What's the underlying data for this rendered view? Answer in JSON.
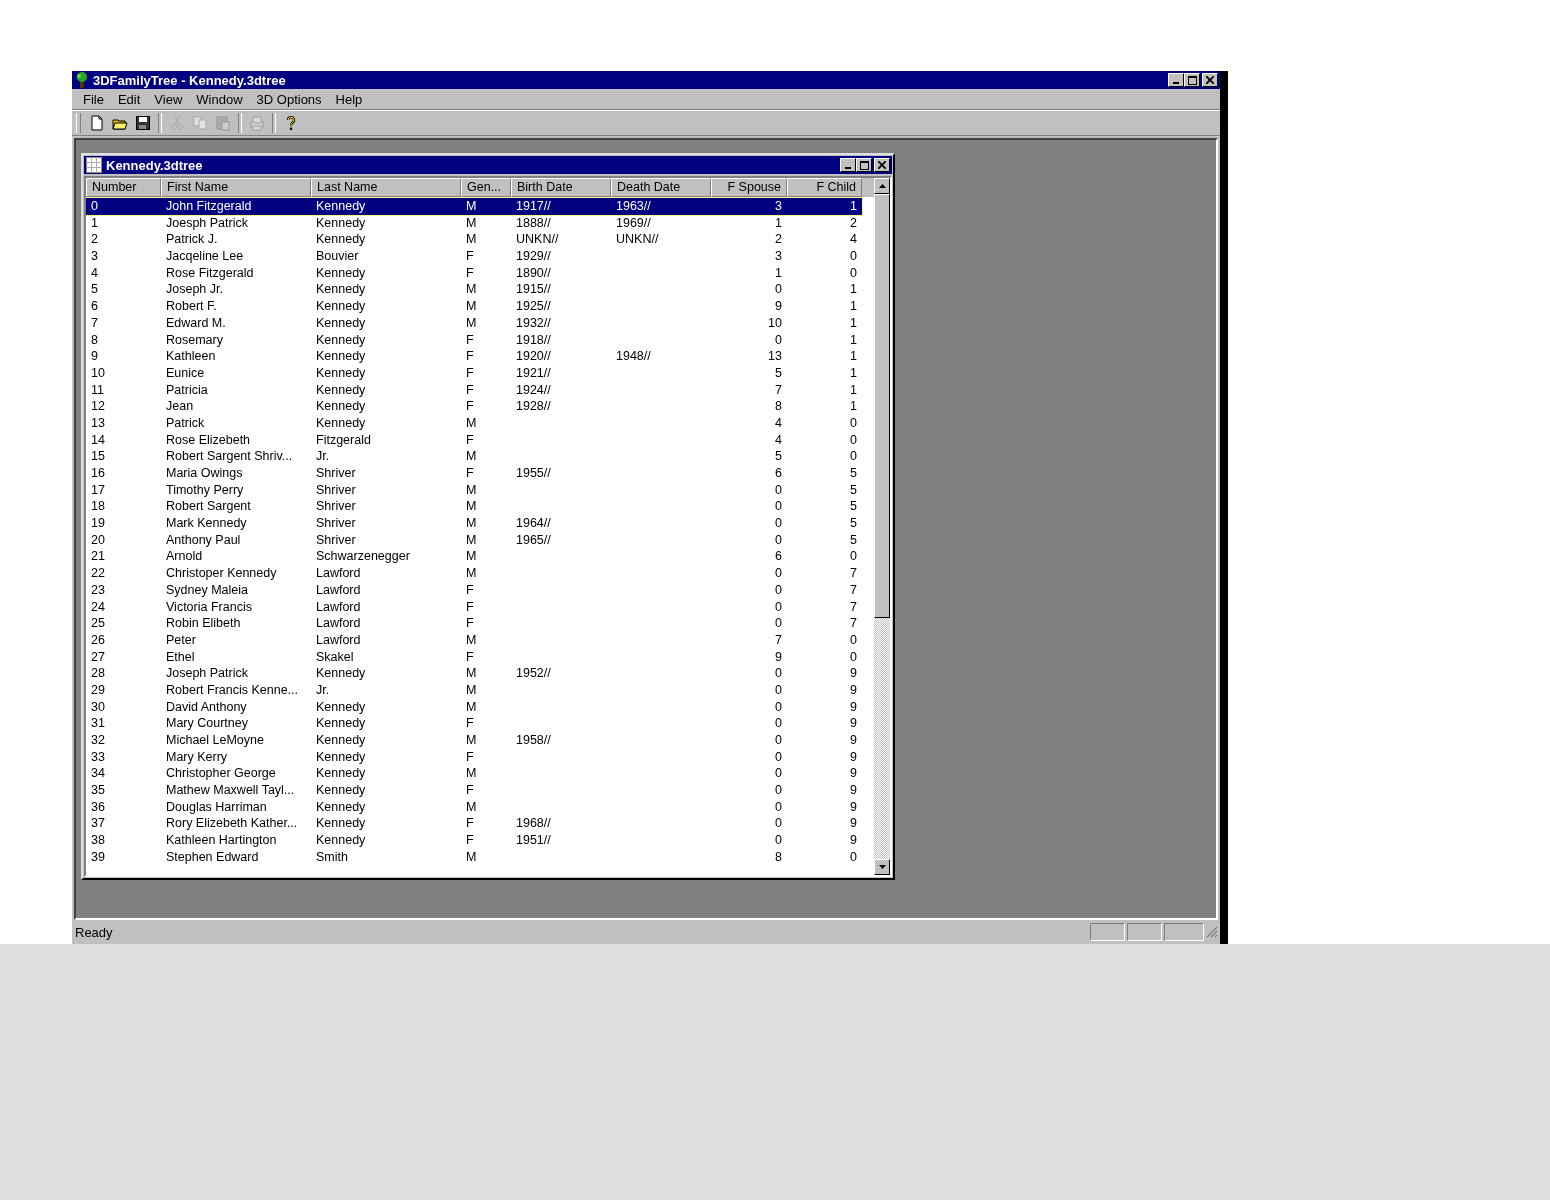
{
  "window": {
    "title": "3DFamilyTree - Kennedy.3dtree"
  },
  "menu": [
    "File",
    "Edit",
    "View",
    "Window",
    "3D Options",
    "Help"
  ],
  "toolbar": [
    {
      "kind": "new",
      "disabled": false
    },
    {
      "kind": "open",
      "disabled": false
    },
    {
      "kind": "save",
      "disabled": false
    },
    {
      "kind": "separator"
    },
    {
      "kind": "cut",
      "disabled": true
    },
    {
      "kind": "copy",
      "disabled": true
    },
    {
      "kind": "paste",
      "disabled": true
    },
    {
      "kind": "separator"
    },
    {
      "kind": "print",
      "disabled": true
    },
    {
      "kind": "separator"
    },
    {
      "kind": "help",
      "disabled": false
    }
  ],
  "document": {
    "title": "Kennedy.3dtree",
    "columns": [
      {
        "label": "Number",
        "kind": "text"
      },
      {
        "label": "First Name",
        "kind": "text"
      },
      {
        "label": "Last Name",
        "kind": "text"
      },
      {
        "label": "Gen...",
        "kind": "text"
      },
      {
        "label": "Birth Date",
        "kind": "text"
      },
      {
        "label": "Death Date",
        "kind": "text"
      },
      {
        "label": "F Spouse",
        "kind": "number"
      },
      {
        "label": "F Child",
        "kind": "number"
      }
    ],
    "rows": [
      {
        "number": "0",
        "first_name": "John Fitzgerald",
        "last_name": "Kennedy",
        "gender": "M",
        "birth_date": "1917//",
        "death_date": "1963//",
        "f_spouse": "3",
        "f_child": "1",
        "selected": true
      },
      {
        "number": "1",
        "first_name": "Joesph Patrick",
        "last_name": "Kennedy",
        "gender": "M",
        "birth_date": "1888//",
        "death_date": "1969//",
        "f_spouse": "1",
        "f_child": "2",
        "selected": false
      },
      {
        "number": "2",
        "first_name": "Patrick J.",
        "last_name": "Kennedy",
        "gender": "M",
        "birth_date": "UNKN//",
        "death_date": "UNKN//",
        "f_spouse": "2",
        "f_child": "4",
        "selected": false
      },
      {
        "number": "3",
        "first_name": "Jacqeline Lee",
        "last_name": "Bouvier",
        "gender": "F",
        "birth_date": "1929//",
        "f_spouse": "3",
        "f_child": "0",
        "selected": false
      },
      {
        "number": "4",
        "first_name": "Rose Fitzgerald",
        "last_name": "Kennedy",
        "gender": "F",
        "birth_date": "1890//",
        "f_spouse": "1",
        "f_child": "0",
        "selected": false
      },
      {
        "number": "5",
        "first_name": "Joseph Jr.",
        "last_name": "Kennedy",
        "gender": "M",
        "birth_date": "1915//",
        "f_spouse": "0",
        "f_child": "1",
        "selected": false
      },
      {
        "number": "6",
        "first_name": "Robert F.",
        "last_name": "Kennedy",
        "gender": "M",
        "birth_date": "1925//",
        "f_spouse": "9",
        "f_child": "1",
        "selected": false
      },
      {
        "number": "7",
        "first_name": "Edward M.",
        "last_name": "Kennedy",
        "gender": "M",
        "birth_date": "1932//",
        "f_spouse": "10",
        "f_child": "1",
        "selected": false
      },
      {
        "number": "8",
        "first_name": "Rosemary",
        "last_name": "Kennedy",
        "gender": "F",
        "birth_date": "1918//",
        "f_spouse": "0",
        "f_child": "1",
        "selected": false
      },
      {
        "number": "9",
        "first_name": "Kathleen",
        "last_name": "Kennedy",
        "gender": "F",
        "birth_date": "1920//",
        "death_date": "1948//",
        "f_spouse": "13",
        "f_child": "1",
        "selected": false
      },
      {
        "number": "10",
        "first_name": "Eunice",
        "last_name": "Kennedy",
        "gender": "F",
        "birth_date": "1921//",
        "f_spouse": "5",
        "f_child": "1",
        "selected": false
      },
      {
        "number": "11",
        "first_name": "Patricia",
        "last_name": "Kennedy",
        "gender": "F",
        "birth_date": "1924//",
        "f_spouse": "7",
        "f_child": "1",
        "selected": false
      },
      {
        "number": "12",
        "first_name": "Jean",
        "last_name": "Kennedy",
        "gender": "F",
        "birth_date": "1928//",
        "f_spouse": "8",
        "f_child": "1",
        "selected": false
      },
      {
        "number": "13",
        "first_name": "Patrick",
        "last_name": "Kennedy",
        "gender": "M",
        "f_spouse": "4",
        "f_child": "0",
        "selected": false
      },
      {
        "number": "14",
        "first_name": "Rose Elizebeth",
        "last_name": "Fitzgerald",
        "gender": "F",
        "f_spouse": "4",
        "f_child": "0",
        "selected": false
      },
      {
        "number": "15",
        "first_name": "Robert Sargent Shriv...",
        "last_name": "Jr.",
        "gender": "M",
        "f_spouse": "5",
        "f_child": "0",
        "selected": false
      },
      {
        "number": "16",
        "first_name": "Maria Owings",
        "last_name": "Shriver",
        "gender": "F",
        "birth_date": "1955//",
        "f_spouse": "6",
        "f_child": "5",
        "selected": false
      },
      {
        "number": "17",
        "first_name": "Timothy Perry",
        "last_name": "Shriver",
        "gender": "M",
        "f_spouse": "0",
        "f_child": "5",
        "selected": false
      },
      {
        "number": "18",
        "first_name": "Robert Sargent",
        "last_name": "Shriver",
        "gender": "M",
        "f_spouse": "0",
        "f_child": "5",
        "selected": false
      },
      {
        "number": "19",
        "first_name": "Mark Kennedy",
        "last_name": "Shriver",
        "gender": "M",
        "birth_date": "1964//",
        "f_spouse": "0",
        "f_child": "5",
        "selected": false
      },
      {
        "number": "20",
        "first_name": "Anthony Paul",
        "last_name": "Shriver",
        "gender": "M",
        "birth_date": "1965//",
        "f_spouse": "0",
        "f_child": "5",
        "selected": false
      },
      {
        "number": "21",
        "first_name": "Arnold",
        "last_name": "Schwarzenegger",
        "gender": "M",
        "f_spouse": "6",
        "f_child": "0",
        "selected": false
      },
      {
        "number": "22",
        "first_name": "Christoper Kennedy",
        "last_name": "Lawford",
        "gender": "M",
        "f_spouse": "0",
        "f_child": "7",
        "selected": false
      },
      {
        "number": "23",
        "first_name": "Sydney Maleia",
        "last_name": "Lawford",
        "gender": "F",
        "f_spouse": "0",
        "f_child": "7",
        "selected": false
      },
      {
        "number": "24",
        "first_name": "Victoria Francis",
        "last_name": "Lawford",
        "gender": "F",
        "f_spouse": "0",
        "f_child": "7",
        "selected": false
      },
      {
        "number": "25",
        "first_name": "Robin Elibeth",
        "last_name": "Lawford",
        "gender": "F",
        "f_spouse": "0",
        "f_child": "7",
        "selected": false
      },
      {
        "number": "26",
        "first_name": "Peter",
        "last_name": "Lawford",
        "gender": "M",
        "f_spouse": "7",
        "f_child": "0",
        "selected": false
      },
      {
        "number": "27",
        "first_name": "Ethel",
        "last_name": "Skakel",
        "gender": "F",
        "f_spouse": "9",
        "f_child": "0",
        "selected": false
      },
      {
        "number": "28",
        "first_name": "Joseph Patrick",
        "last_name": "Kennedy",
        "gender": "M",
        "birth_date": "1952//",
        "f_spouse": "0",
        "f_child": "9",
        "selected": false
      },
      {
        "number": "29",
        "first_name": "Robert Francis Kenne...",
        "last_name": "Jr.",
        "gender": "M",
        "f_spouse": "0",
        "f_child": "9",
        "selected": false
      },
      {
        "number": "30",
        "first_name": "David Anthony",
        "last_name": "Kennedy",
        "gender": "M",
        "f_spouse": "0",
        "f_child": "9",
        "selected": false
      },
      {
        "number": "31",
        "first_name": "Mary Courtney",
        "last_name": "Kennedy",
        "gender": "F",
        "f_spouse": "0",
        "f_child": "9",
        "selected": false
      },
      {
        "number": "32",
        "first_name": "Michael LeMoyne",
        "last_name": "Kennedy",
        "gender": "M",
        "birth_date": "1958//",
        "f_spouse": "0",
        "f_child": "9",
        "selected": false
      },
      {
        "number": "33",
        "first_name": "Mary Kerry",
        "last_name": "Kennedy",
        "gender": "F",
        "f_spouse": "0",
        "f_child": "9",
        "selected": false
      },
      {
        "number": "34",
        "first_name": "Christopher George",
        "last_name": "Kennedy",
        "gender": "M",
        "f_spouse": "0",
        "f_child": "9",
        "selected": false
      },
      {
        "number": "35",
        "first_name": "Mathew Maxwell Tayl...",
        "last_name": "Kennedy",
        "gender": "F",
        "f_spouse": "0",
        "f_child": "9",
        "selected": false
      },
      {
        "number": "36",
        "first_name": "Douglas Harriman",
        "last_name": "Kennedy",
        "gender": "M",
        "f_spouse": "0",
        "f_child": "9",
        "selected": false
      },
      {
        "number": "37",
        "first_name": "Rory Elizebeth Kather...",
        "last_name": "Kennedy",
        "gender": "F",
        "birth_date": "1968//",
        "f_spouse": "0",
        "f_child": "9",
        "selected": false
      },
      {
        "number": "38",
        "first_name": "Kathleen Hartington",
        "last_name": "Kennedy",
        "gender": "F",
        "birth_date": "1951//",
        "f_spouse": "0",
        "f_child": "9",
        "selected": false
      },
      {
        "number": "39",
        "first_name": "Stephen Edward",
        "last_name": "Smith",
        "gender": "M",
        "f_spouse": "8",
        "f_child": "0",
        "selected": false
      }
    ]
  },
  "status_bar": {
    "text": "Ready"
  }
}
